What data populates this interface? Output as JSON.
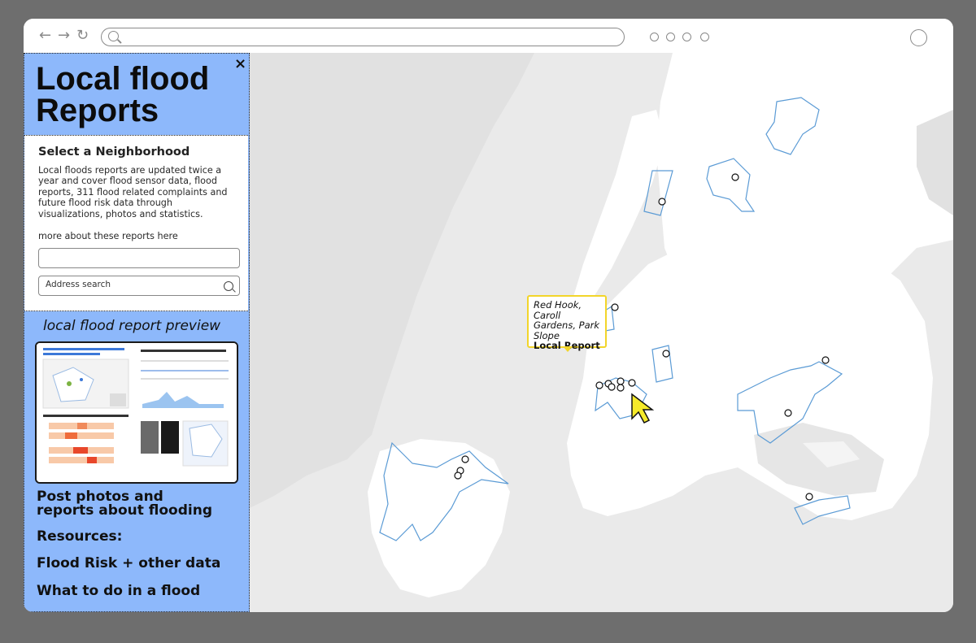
{
  "browser": {
    "back_icon": "arrow-left-icon",
    "forward_icon": "arrow-right-icon",
    "reload_icon": "reload-icon",
    "url": ""
  },
  "sidebar": {
    "close_label": "×",
    "title": "Local flood Reports",
    "select_heading": "Select a Neighborhood",
    "description": "Local floods reports are updated twice a year and cover flood sensor data, flood reports, 311 flood related complaints and future flood risk data through visualizations, photos and statistics.",
    "more_link": "more about these reports here",
    "blank_input_value": "",
    "address_search_placeholder": "Address search",
    "preview_heading": "local flood report preview",
    "links": [
      "Post photos and reports about flooding",
      "Resources:",
      "Flood Risk + other data",
      "What to do in a flood"
    ]
  },
  "map": {
    "tooltip_place": "Red Hook, Caroll Gardens, Park Slope",
    "tooltip_report": "Local Report",
    "neighborhood_color": "#5b9bd5",
    "water_color": "#eaeaea",
    "land_color": "#ffffff"
  },
  "colors": {
    "sidebar_bg": "#8db8fb",
    "tooltip_border": "#f2d52a",
    "cursor": "#f5ea2a"
  }
}
